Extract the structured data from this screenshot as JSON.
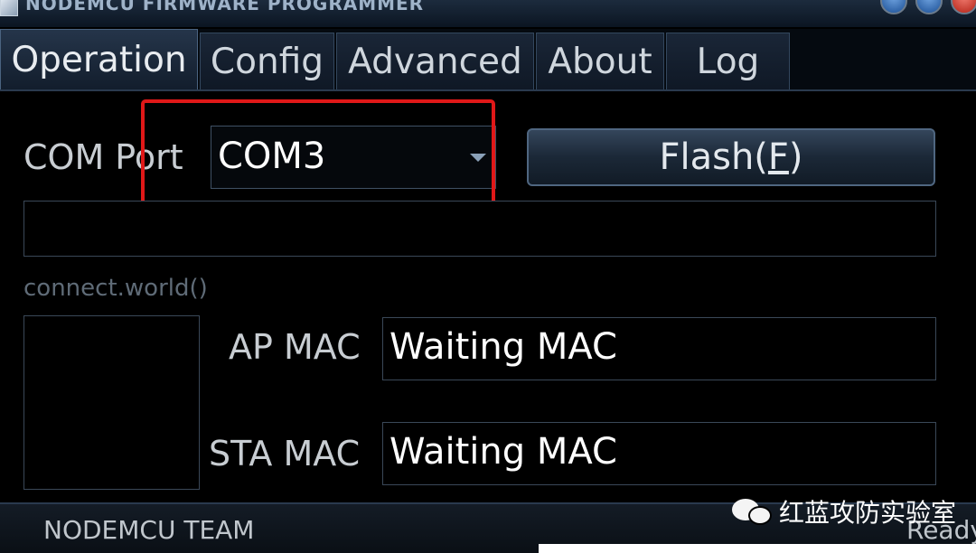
{
  "window": {
    "title": "NODEMCU FIRMWARE PROGRAMMER"
  },
  "tabs": [
    {
      "label": "Operation",
      "active": true
    },
    {
      "label": "Config",
      "active": false
    },
    {
      "label": "Advanced",
      "active": false
    },
    {
      "label": "About",
      "active": false
    },
    {
      "label": "Log",
      "active": false
    }
  ],
  "operation": {
    "com_port_label": "COM Port",
    "com_port_value": "COM3",
    "flash_label_prefix": "Flash(",
    "flash_mnemonic": "F",
    "flash_label_suffix": ")",
    "progress_text": "",
    "motto": "connect.world()",
    "ap_mac_label": "AP MAC",
    "ap_mac_value": "Waiting MAC",
    "sta_mac_label": "STA MAC",
    "sta_mac_value": "Waiting MAC"
  },
  "status": {
    "team": "NODEMCU TEAM",
    "state": "Ready"
  },
  "watermark": {
    "text": "红蓝攻防实验室",
    "icon": "wechat-icon"
  },
  "colors": {
    "highlight_box": "#e01818",
    "background": "#000000",
    "accent_blue": "#4f6680"
  }
}
